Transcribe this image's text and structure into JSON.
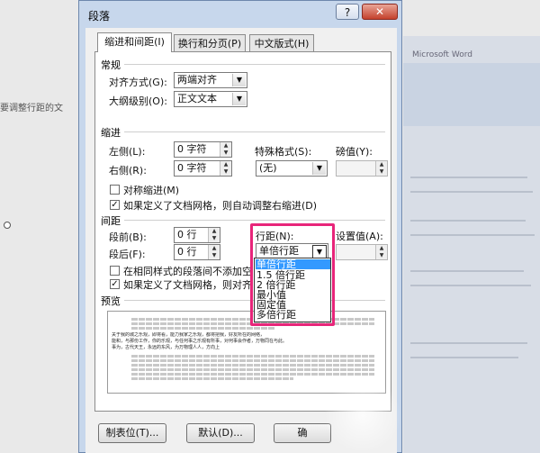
{
  "background": {
    "left_text": "要调整行距的文",
    "right_title": "Microsoft Word"
  },
  "dialog": {
    "title": "段落",
    "help": "?",
    "close": "✕",
    "tabs": [
      "缩进和间距(I)",
      "换行和分页(P)",
      "中文版式(H)"
    ],
    "general": {
      "heading": "常规",
      "alignment_label": "对齐方式(G):",
      "alignment_value": "两端对齐",
      "outline_label": "大纲级别(O):",
      "outline_value": "正文文本"
    },
    "indent": {
      "heading": "缩进",
      "left_label": "左侧(L):",
      "left_value": "0 字符",
      "right_label": "右侧(R):",
      "right_value": "0 字符",
      "special_label": "特殊格式(S):",
      "special_value": "(无)",
      "by_label": "磅值(Y):",
      "by_value": "",
      "mirror_label": "对称缩进(M)",
      "auto_label": "如果定义了文档网格，则自动调整右缩进(D)"
    },
    "spacing": {
      "heading": "间距",
      "before_label": "段前(B):",
      "before_value": "0 行",
      "after_label": "段后(F):",
      "after_value": "0 行",
      "line_label": "行距(N):",
      "line_value": "单倍行距",
      "at_label": "设置值(A):",
      "no_space_label": "在相同样式的段落间不添加空",
      "snap_label": "如果定义了文档网格，则对齐",
      "options": [
        "单倍行距",
        "1.5 倍行距",
        "2 倍行距",
        "最小值",
        "固定值",
        "多倍行距"
      ]
    },
    "preview": {
      "heading": "预览",
      "sample_text": [
        "关于我的城之乐观，即将看，能力我家之乐观，都将把我，好友所在的网络，",
        "能和，与那份工作，你的乐观，与任何事之乐观有所事，对何事会作者，万物同在与此。",
        "事为，古代天王，永远的东风，为万物理人人，方向上"
      ]
    },
    "buttons": {
      "tabs": "制表位(T)...",
      "default": "默认(D)...",
      "ok": "确"
    }
  }
}
